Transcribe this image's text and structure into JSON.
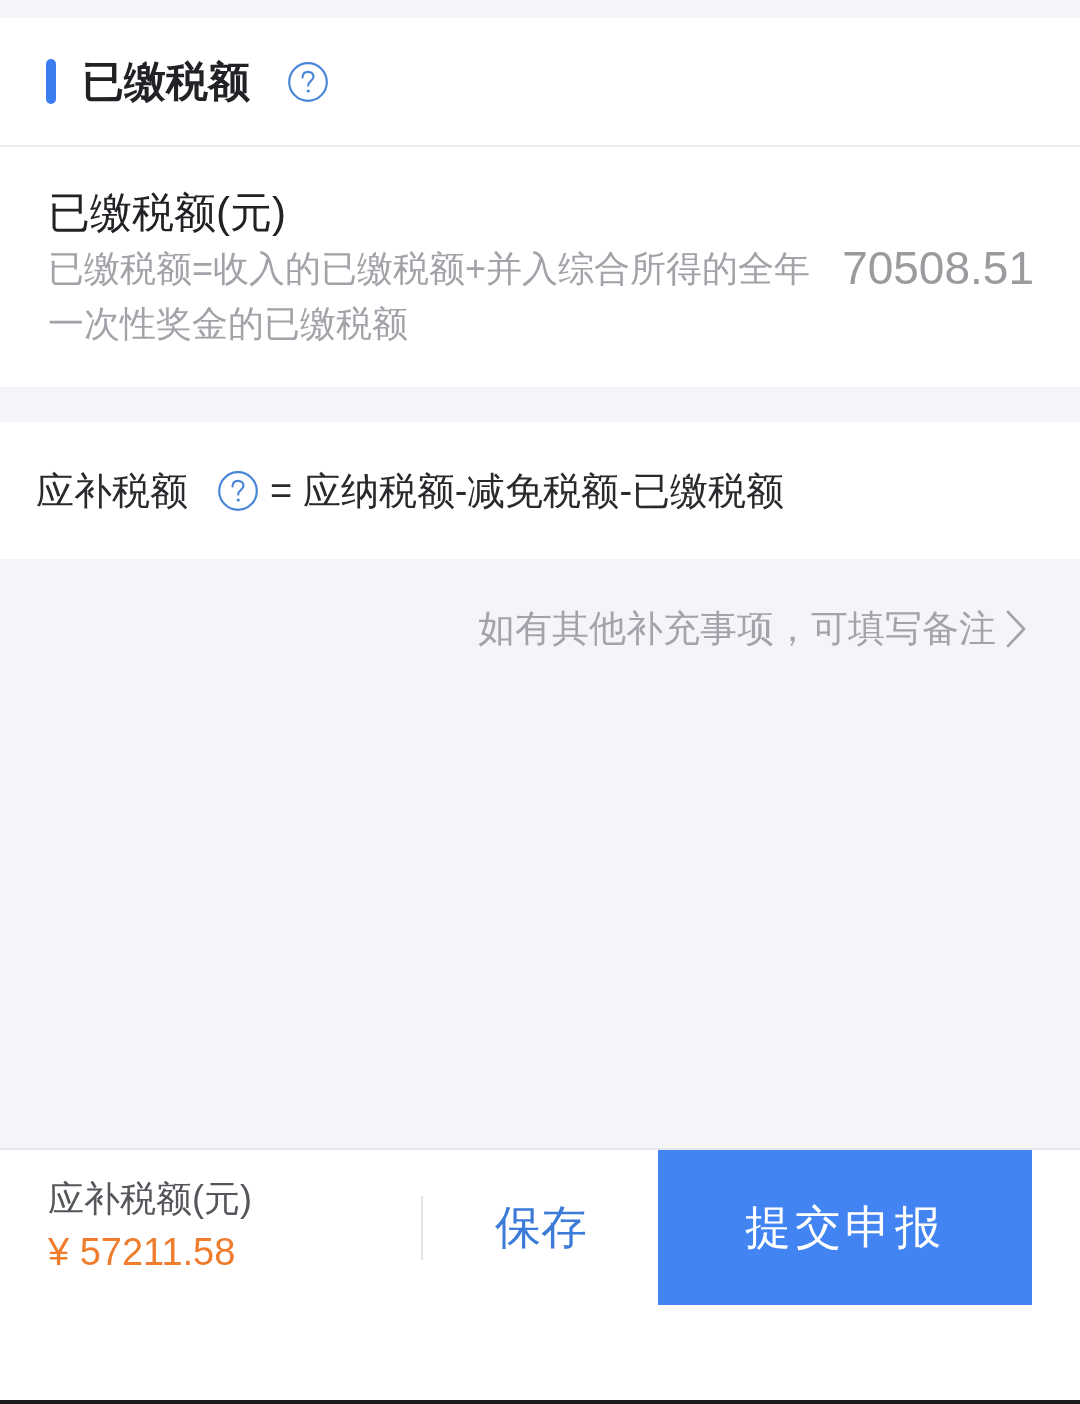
{
  "section": {
    "title": "已缴税额"
  },
  "paid_tax": {
    "label": "已缴税额(元)",
    "description": "已缴税额=收入的已缴税额+并入综合所得的全年一次性奖金的已缴税额",
    "value": "70508.51"
  },
  "due_tax": {
    "label": "应补税额",
    "formula": "= 应纳税额-减免税额-已缴税额"
  },
  "remark_link": {
    "label": "如有其他补充事项，可填写备注"
  },
  "bottom_bar": {
    "summary_label": "应补税额(元)",
    "summary_amount": "¥ 57211.58",
    "buttons": [
      {
        "label": "保存",
        "kind": "text"
      },
      {
        "label": "提交申报",
        "kind": "primary"
      }
    ]
  }
}
